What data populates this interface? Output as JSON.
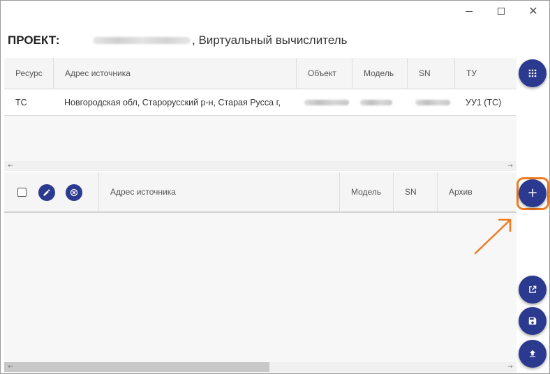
{
  "window": {
    "minimize_icon": "minimize-icon",
    "maximize_icon": "maximize-icon",
    "close_icon": "close-icon",
    "close_glyph": "✕"
  },
  "project": {
    "label": "ПРОЕКТ:",
    "name": ", Виртуальный вычислитель"
  },
  "top_table": {
    "columns": [
      "Ресурс",
      "Адрес источника",
      "Объект",
      "Модель",
      "SN",
      "ТУ"
    ],
    "rows": [
      {
        "resource": "ТС",
        "address": "Новгородская обл, Старорусский р-н, Старая Русса г,",
        "tu": "УУ1 (ТС)"
      }
    ]
  },
  "bottom_table": {
    "columns": [
      "Адрес источника",
      "Модель",
      "SN",
      "Архив"
    ],
    "edit_icon": "pencil-icon",
    "delete_icon": "close-circle-icon"
  },
  "fabs": {
    "grid_icon": "grid-dots-icon",
    "add_icon": "plus-icon",
    "add_glyph": "+",
    "export_icon": "open-in-new-icon",
    "save_icon": "floppy-disk-icon",
    "upload_icon": "upload-icon"
  },
  "scroll": {
    "left_glyph": "←",
    "right_glyph": "→"
  },
  "colors": {
    "fab": "#2b3a8f",
    "highlight": "#f07a20"
  }
}
